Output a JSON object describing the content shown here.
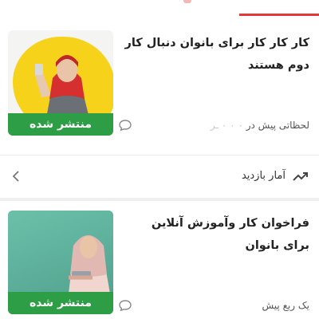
{
  "posts": [
    {
      "title": "کار کار کار برای بانوان دنبال کار دوم هستند",
      "badge": "منتشر شده",
      "time": "لحظاتی پیش در",
      "time_faded": "۰ ۰ ۰ ـر"
    },
    {
      "title": "فراخوان کار وآموزش آنلاین برای بانوان",
      "badge": "منتشر شده",
      "time": "یک ربع پیش",
      "time_faded": ""
    }
  ],
  "stats": {
    "label": "آمار بازدید"
  },
  "icons": {
    "comment": "comment-icon",
    "trend": "trending-up-icon",
    "chevron": "chevron-left-icon"
  },
  "colors": {
    "accent": "#e53935",
    "published": "#2e9e46"
  }
}
